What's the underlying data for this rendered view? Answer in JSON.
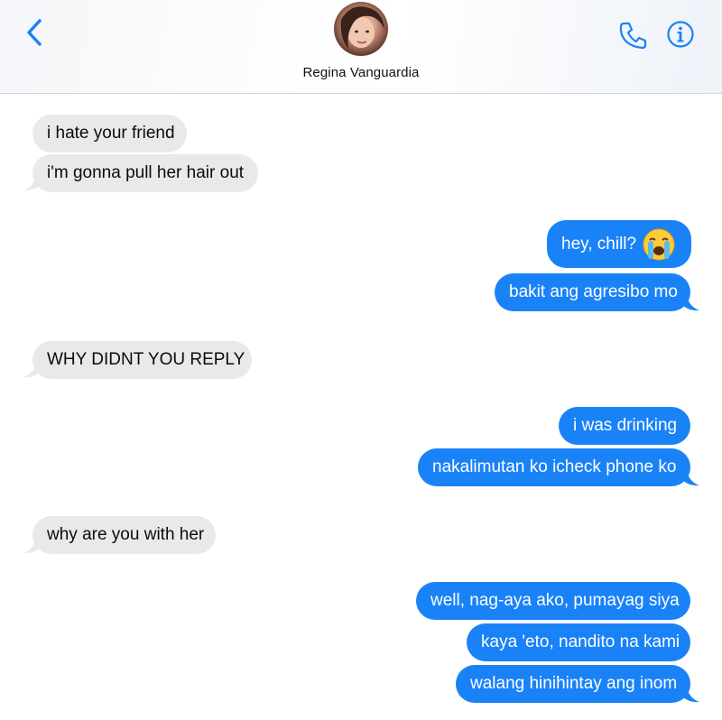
{
  "header": {
    "contact_name": "Regina Vanguardia",
    "back_icon": "chevron-left-icon",
    "phone_icon": "phone-icon",
    "info_icon": "info-icon"
  },
  "colors": {
    "sent_bubble": "#1a82f7",
    "received_bubble": "#e9e9eb",
    "accent": "#1a82f7"
  },
  "messages": [
    {
      "direction": "received",
      "text": "i hate your friend"
    },
    {
      "direction": "received",
      "text": "i'm gonna pull her hair out"
    },
    {
      "direction": "sent",
      "text": "hey, chill?",
      "emoji": "loudly-crying-face"
    },
    {
      "direction": "sent",
      "text": "bakit ang agresibo mo"
    },
    {
      "direction": "received",
      "text": "WHY DIDNT YOU REPLY"
    },
    {
      "direction": "sent",
      "text": "i was drinking"
    },
    {
      "direction": "sent",
      "text": "nakalimutan ko icheck phone ko"
    },
    {
      "direction": "received",
      "text": "why are you with her"
    },
    {
      "direction": "sent",
      "text": "well, nag-aya ako, pumayag siya"
    },
    {
      "direction": "sent",
      "text": "kaya 'eto, nandito na kami"
    },
    {
      "direction": "sent",
      "text": "walang hinihintay ang inom"
    }
  ]
}
